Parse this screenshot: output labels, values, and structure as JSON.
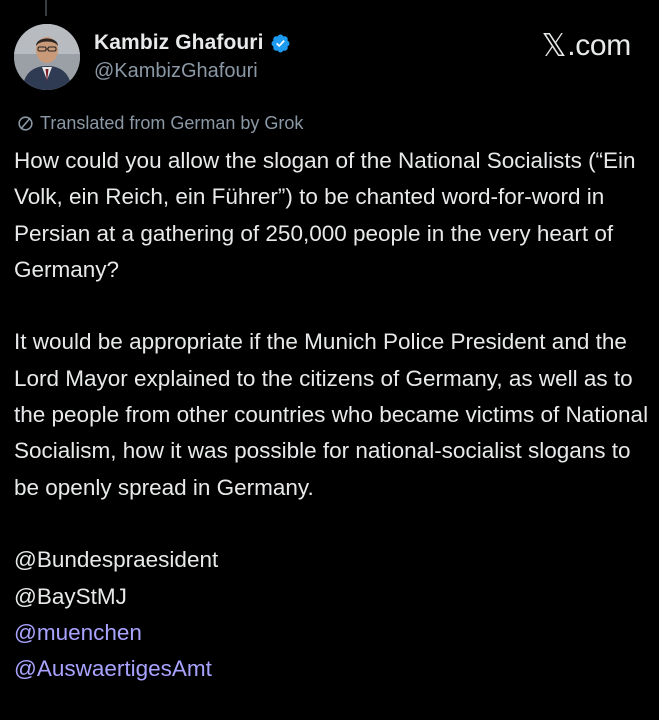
{
  "header": {
    "display_name": "Kambiz Ghafouri",
    "handle": "@KambizGhafouri",
    "brand_letter": "𝕏",
    "brand_suffix": ".com",
    "verified_icon": "verified-badge-icon",
    "verified_color": "#1d9bf0"
  },
  "translation_note": "Translated from German by Grok",
  "post": {
    "paragraph_1": "How could you allow the slogan of the National Socialists (“Ein Volk, ein Reich, ein Führer”) to be chanted word-for-word in Persian at a gathering of 250,000 people in the very heart of Germany?",
    "paragraph_2": "It would be appropriate if the Munich Police President and the Lord Mayor explained to the citizens of Germany, as well as to the people from other countries who became victims of National Socialism, how it was possible for national-socialist slogans to be openly spread in Germany.",
    "mentions": [
      "@Bundespraesident",
      "@BayStMJ",
      "@muenchen",
      "@AuswaertigesAmt"
    ]
  },
  "colors": {
    "background": "#000000",
    "text": "#e7e9ea",
    "secondary": "#8b98a5",
    "link": "#a8a3ff"
  }
}
